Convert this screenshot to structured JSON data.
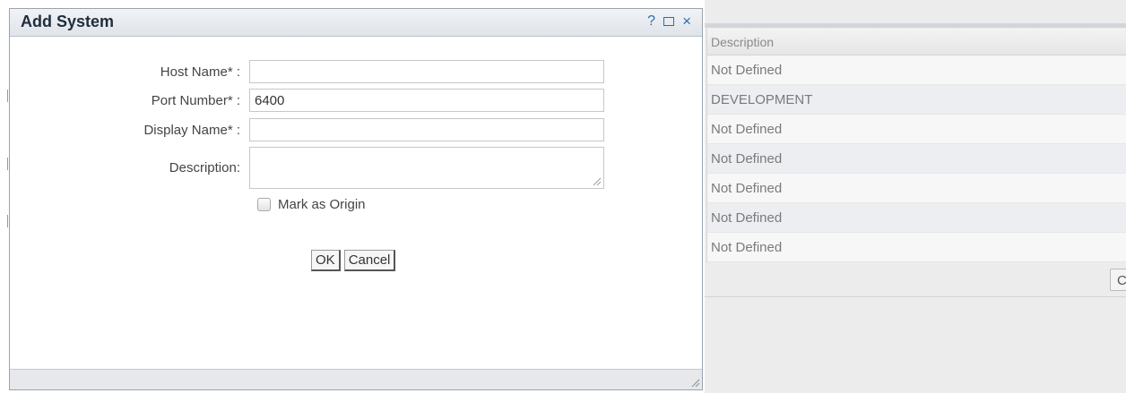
{
  "dialog": {
    "title": "Add System",
    "controls": {
      "help_icon": "?",
      "maximize_icon": "square-icon",
      "close_icon": "×"
    },
    "fields": {
      "host_name": {
        "label": "Host Name* :",
        "value": ""
      },
      "port_number": {
        "label": "Port Number* :",
        "value": "6400"
      },
      "display_name": {
        "label": "Display Name* :",
        "value": ""
      },
      "description": {
        "label": "Description:",
        "value": ""
      }
    },
    "mark_as_origin": {
      "label": "Mark as Origin",
      "checked": false
    },
    "buttons": {
      "ok": "OK",
      "cancel": "Cancel"
    }
  },
  "background_grid": {
    "column_header": "Description",
    "rows": [
      "Not Defined",
      "DEVELOPMENT",
      "Not Defined",
      "Not Defined",
      "Not Defined",
      "Not Defined",
      "Not Defined"
    ],
    "partial_button_label": "Cl"
  },
  "colors": {
    "title_text": "#1f2d3d",
    "accent_icons": "#2b6cb0",
    "titlebar_bg": "#dfe4ea",
    "grid_bg": "#ececec"
  }
}
